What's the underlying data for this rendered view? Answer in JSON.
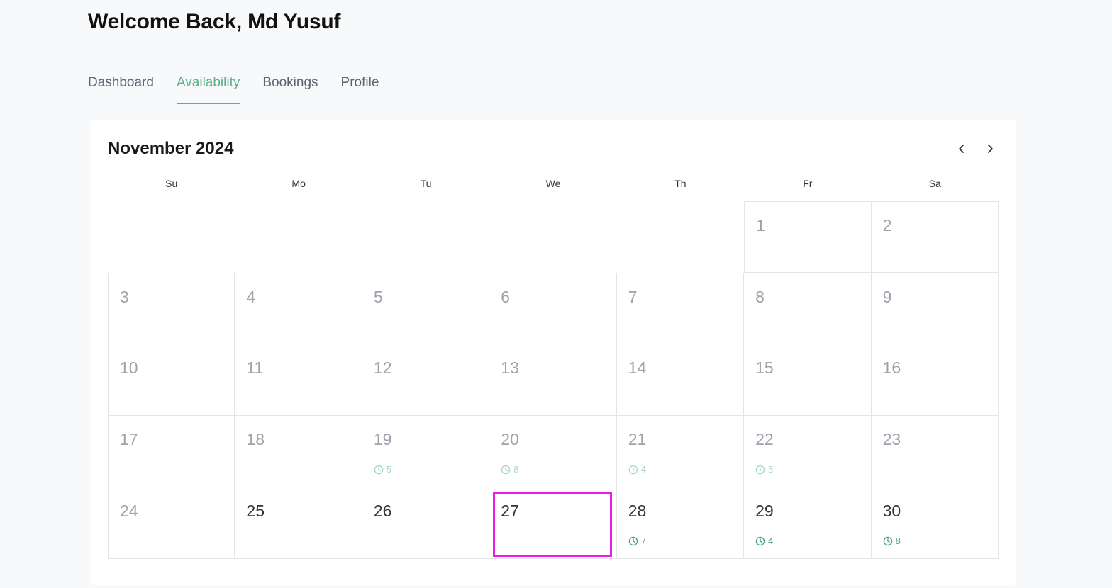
{
  "header": {
    "title": "Welcome Back, Md Yusuf"
  },
  "tabs": [
    {
      "label": "Dashboard",
      "active": false
    },
    {
      "label": "Availability",
      "active": true
    },
    {
      "label": "Bookings",
      "active": false
    },
    {
      "label": "Profile",
      "active": false
    }
  ],
  "calendar": {
    "month_label": "November 2024",
    "prev_icon": "chevron-left-icon",
    "next_icon": "chevron-right-icon",
    "weekdays": [
      "Su",
      "Mo",
      "Tu",
      "We",
      "Th",
      "Fr",
      "Sa"
    ],
    "leading_blank_days": 5,
    "days": [
      {
        "day": "1",
        "slots": null,
        "active": false
      },
      {
        "day": "2",
        "slots": null,
        "active": false
      },
      {
        "day": "3",
        "slots": null,
        "active": false
      },
      {
        "day": "4",
        "slots": null,
        "active": false
      },
      {
        "day": "5",
        "slots": null,
        "active": false
      },
      {
        "day": "6",
        "slots": null,
        "active": false
      },
      {
        "day": "7",
        "slots": null,
        "active": false
      },
      {
        "day": "8",
        "slots": null,
        "active": false
      },
      {
        "day": "9",
        "slots": null,
        "active": false
      },
      {
        "day": "10",
        "slots": null,
        "active": false
      },
      {
        "day": "11",
        "slots": null,
        "active": false
      },
      {
        "day": "12",
        "slots": null,
        "active": false
      },
      {
        "day": "13",
        "slots": null,
        "active": false
      },
      {
        "day": "14",
        "slots": null,
        "active": false
      },
      {
        "day": "15",
        "slots": null,
        "active": false
      },
      {
        "day": "16",
        "slots": null,
        "active": false
      },
      {
        "day": "17",
        "slots": null,
        "active": false
      },
      {
        "day": "18",
        "slots": null,
        "active": false
      },
      {
        "day": "19",
        "slots": "5",
        "active": false
      },
      {
        "day": "20",
        "slots": "8",
        "active": false
      },
      {
        "day": "21",
        "slots": "4",
        "active": false
      },
      {
        "day": "22",
        "slots": "5",
        "active": false
      },
      {
        "day": "23",
        "slots": null,
        "active": false
      },
      {
        "day": "24",
        "slots": null,
        "active": false
      },
      {
        "day": "25",
        "slots": null,
        "active": true
      },
      {
        "day": "26",
        "slots": null,
        "active": true
      },
      {
        "day": "27",
        "slots": null,
        "active": true,
        "highlighted": true
      },
      {
        "day": "28",
        "slots": "7",
        "active": true
      },
      {
        "day": "29",
        "slots": "4",
        "active": true
      },
      {
        "day": "30",
        "slots": "8",
        "active": true
      }
    ]
  },
  "colors": {
    "accent": "#5ab08a",
    "highlight": "#ec1ce4",
    "muted_text": "#9ca3ab"
  }
}
